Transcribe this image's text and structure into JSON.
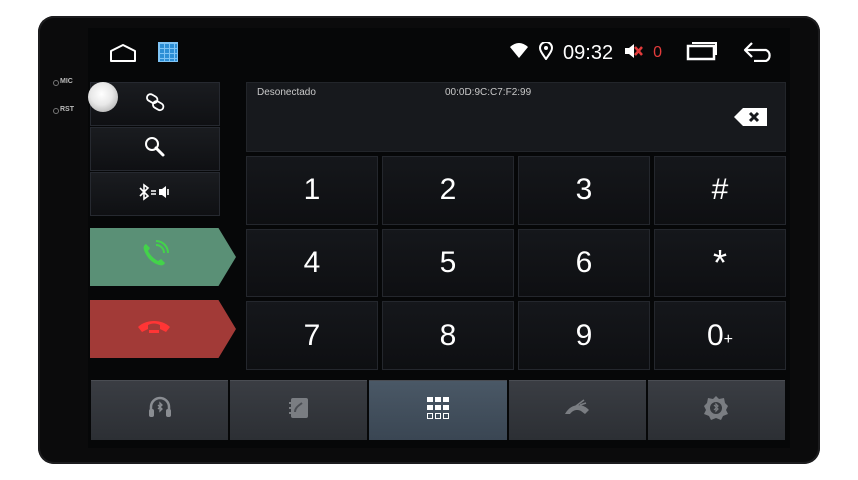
{
  "device": {
    "side_labels": [
      "MIC",
      "RST"
    ]
  },
  "status_bar": {
    "time": "09:32",
    "volume_level": "0",
    "icons": [
      "home-icon",
      "app-grid-icon",
      "wifi-icon",
      "location-icon",
      "mute-icon",
      "recent-apps-icon",
      "back-icon"
    ]
  },
  "left_panel": {
    "buttons": [
      "link-icon",
      "search-icon",
      "bluetooth-audio-icon"
    ],
    "accept_icon": "phone-accept-icon",
    "reject_icon": "phone-hangup-icon",
    "accept_color": "#5a9076",
    "reject_color": "#a23a37"
  },
  "display": {
    "status": "Desonectado",
    "mac": "00:0D:9C:C7:F2:99"
  },
  "keypad": {
    "keys": [
      "1",
      "2",
      "3",
      "#",
      "4",
      "5",
      "6",
      "*",
      "7",
      "8",
      "9",
      "0"
    ],
    "plus": "+"
  },
  "bottom_nav": {
    "tabs": [
      "headset-icon",
      "contacts-icon",
      "dialpad-icon",
      "call-log-icon",
      "settings-icon"
    ],
    "active": "dialpad-icon"
  }
}
